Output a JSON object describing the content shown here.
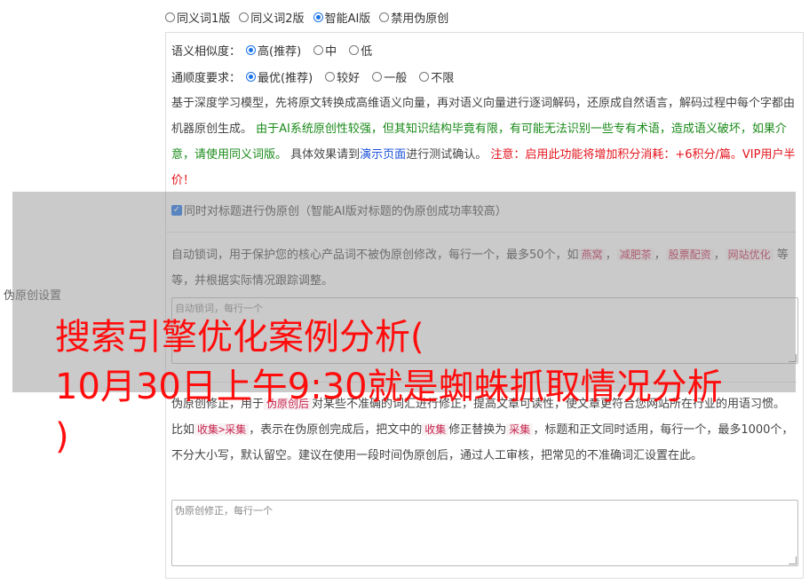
{
  "row_label": "伪原创设置",
  "modes": [
    {
      "label": "同义词1版",
      "selected": false
    },
    {
      "label": "同义词2版",
      "selected": false
    },
    {
      "label": "智能AI版",
      "selected": true
    },
    {
      "label": "禁用伪原创",
      "selected": false
    }
  ],
  "similarity": {
    "label": "语义相似度：",
    "options": [
      {
        "label": "高(推荐)",
        "selected": true
      },
      {
        "label": "中",
        "selected": false
      },
      {
        "label": "低",
        "selected": false
      }
    ]
  },
  "fluency": {
    "label": "通顺度要求：",
    "options": [
      {
        "label": "最优(推荐)",
        "selected": true
      },
      {
        "label": "较好",
        "selected": false
      },
      {
        "label": "一般",
        "selected": false
      },
      {
        "label": "不限",
        "selected": false
      }
    ]
  },
  "description": {
    "part1": "基于深度学习模型，先将原文转换成高维语义向量，再对语义向量进行逐词解码，还原成自然语言，解码过程中每个字都由机器原创生成。",
    "part2_green": "由于AI系统原创性较强，但其知识结构毕竟有限，有可能无法识别一些专有术语，造成语义破坏，如果介意，请使用同义词版。",
    "part3": "具体效果请到",
    "link": "演示页面",
    "part4": "进行测试确认。",
    "part5_red": "注意：启用此功能将增加积分消耗：+6积分/篇。VIP用户半价！"
  },
  "title_checkbox": {
    "label": "同时对标题进行伪原创（智能AI版对标题的伪原创成功率较高）",
    "checked": true
  },
  "lock_words": {
    "desc_prefix": "自动锁词，用于保护您的核心产品词不被伪原创修改，每行一个，最多50个，如",
    "examples": [
      "燕窝",
      "减肥茶",
      "股票配资",
      "网站优化"
    ],
    "desc_suffix": "等等，并根据实际情况跟踪调整。",
    "placeholder": "自动锁词，每行一个"
  },
  "corrections": {
    "desc_a": "伪原创修正，用于",
    "kw1": "伪原创后",
    "desc_b": "对某些不准确的词汇进行修正，提高文章可读性，使文章更符合您网站所在行业的用语习惯。比如",
    "kw2": "收集>采集",
    "desc_c": "，表示在伪原创完成后，把文中的",
    "kw3": "收集",
    "desc_d": "修正替换为",
    "kw4": "采集",
    "desc_e": "，标题和正文同时适用，每行一个，最多1000个，不分大小写，默认留空。建议在使用一段时间伪原创后，通过人工审核，把常见的不准确词汇设置在此。",
    "placeholder": "伪原创修正，每行一个"
  },
  "overlay_headline": "搜索引擎优化案例分析(\n10月30日上午9:30就是蜘蛛抓取情况分析\n)",
  "colors": {
    "accent": "#1a73e8",
    "green": "#1a8a1a",
    "red": "#e4131b",
    "headline": "#ff0d0d"
  }
}
